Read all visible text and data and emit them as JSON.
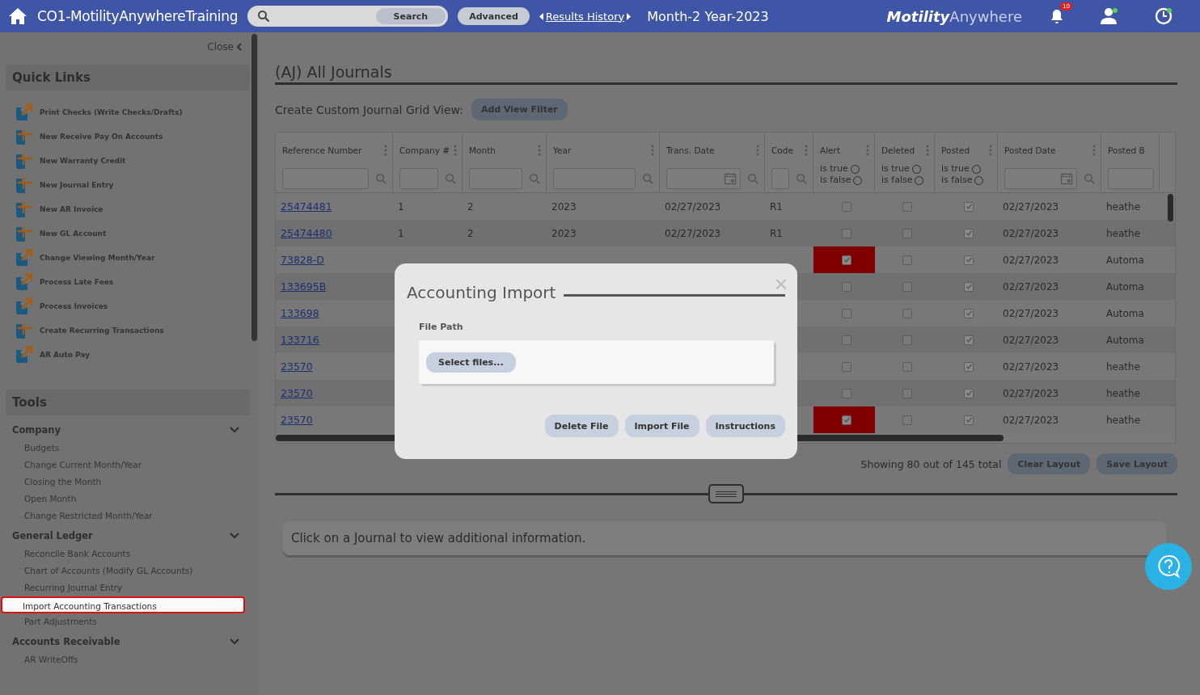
{
  "topbar": {
    "title": "CO1-MotilityAnywhereTraining",
    "search_button": "Search",
    "advanced_button": "Advanced",
    "history_link": "Results History",
    "period": "Month-2 Year-2023",
    "brand_bold": "Motility",
    "brand_light": "Anywhere",
    "notification_count": "10"
  },
  "sidebar": {
    "close": "Close",
    "quick_links_title": "Quick Links",
    "quick_links": [
      {
        "label": "Print Checks (Write Checks/Drafts)",
        "kind": "open"
      },
      {
        "label": "New Receive Pay On Accounts",
        "kind": "new"
      },
      {
        "label": "New Warranty Credit",
        "kind": "new"
      },
      {
        "label": "New Journal Entry",
        "kind": "new"
      },
      {
        "label": "New AR Invoice",
        "kind": "new"
      },
      {
        "label": "New GL Account",
        "kind": "new"
      },
      {
        "label": "Change Viewing Month/Year",
        "kind": "open"
      },
      {
        "label": "Process Late Fees",
        "kind": "open"
      },
      {
        "label": "Process Invoices",
        "kind": "open"
      },
      {
        "label": "Create Recurring Transactions",
        "kind": "new"
      },
      {
        "label": "AR Auto Pay",
        "kind": "open"
      }
    ],
    "tools_title": "Tools",
    "tools": [
      {
        "label": "Company",
        "expanded": true,
        "children": [
          {
            "label": "Budgets",
            "selected": false
          },
          {
            "label": "Change Current Month/Year",
            "selected": false
          },
          {
            "label": "Closing the Month",
            "selected": false
          },
          {
            "label": "Open Month",
            "selected": false
          },
          {
            "label": "Change Restricted Month/Year",
            "selected": false
          }
        ]
      },
      {
        "label": "General Ledger",
        "expanded": true,
        "children": [
          {
            "label": "Reconcile Bank Accounts",
            "selected": false
          },
          {
            "label": "Chart of Accounts (Modify GL Accounts)",
            "selected": false
          },
          {
            "label": "Recurring Journal Entry",
            "selected": false
          },
          {
            "label": "Import Accounting Transactions",
            "selected": true
          },
          {
            "label": "Part Adjustments",
            "selected": false
          }
        ]
      },
      {
        "label": "Accounts Receivable",
        "expanded": true,
        "children": [
          {
            "label": "AR WriteOffs",
            "selected": false
          }
        ]
      }
    ]
  },
  "main": {
    "title": "(AJ) All Journals",
    "custom_view_label": "Create Custom Journal Grid View:",
    "add_filter_button": "Add View Filter",
    "table": {
      "columns": [
        {
          "label": "Reference Number",
          "kind": "text"
        },
        {
          "label": "Company #",
          "kind": "text"
        },
        {
          "label": "Month",
          "kind": "text"
        },
        {
          "label": "Year",
          "kind": "text"
        },
        {
          "label": "Trans. Date",
          "kind": "date"
        },
        {
          "label": "Code",
          "kind": "text"
        },
        {
          "label": "Alert",
          "kind": "bool",
          "filter_true": "is true",
          "filter_false": "is false"
        },
        {
          "label": "Deleted",
          "kind": "bool",
          "filter_true": "is true",
          "filter_false": "is false"
        },
        {
          "label": "Posted",
          "kind": "bool",
          "filter_true": "is true",
          "filter_false": "is false"
        },
        {
          "label": "Posted Date",
          "kind": "date"
        },
        {
          "label": "Posted B",
          "kind": "text"
        }
      ],
      "rows": [
        {
          "ref": "25474481",
          "company": "1",
          "month": "2",
          "year": "2023",
          "trans_date": "02/27/2023",
          "code": "R1",
          "alert": false,
          "deleted": false,
          "posted": true,
          "posted_date": "02/27/2023",
          "posted_by": "heathe"
        },
        {
          "ref": "25474480",
          "company": "1",
          "month": "2",
          "year": "2023",
          "trans_date": "02/27/2023",
          "code": "R1",
          "alert": false,
          "deleted": false,
          "posted": true,
          "posted_date": "02/27/2023",
          "posted_by": "heathe"
        },
        {
          "ref": "73828-D",
          "alert": true,
          "deleted": false,
          "posted": true,
          "posted_date": "02/27/2023",
          "posted_by": "Automa"
        },
        {
          "ref": "133695B",
          "alert": false,
          "deleted": false,
          "posted": true,
          "posted_date": "02/27/2023",
          "posted_by": "Automa"
        },
        {
          "ref": "133698",
          "alert": false,
          "deleted": false,
          "posted": true,
          "posted_date": "02/27/2023",
          "posted_by": "Automa"
        },
        {
          "ref": "133716",
          "alert": false,
          "deleted": false,
          "posted": true,
          "posted_date": "02/27/2023",
          "posted_by": "Automa"
        },
        {
          "ref": "23570",
          "alert": false,
          "deleted": false,
          "posted": true,
          "posted_date": "02/27/2023",
          "posted_by": "heathe"
        },
        {
          "ref": "23570",
          "alert": false,
          "deleted": false,
          "posted": true,
          "posted_date": "02/27/2023",
          "posted_by": "heathe"
        },
        {
          "ref": "23570",
          "alert": true,
          "deleted": false,
          "posted": true,
          "posted_date": "02/27/2023",
          "posted_by": "heathe"
        }
      ]
    },
    "showing": "Showing 80 out of 145 total",
    "clear_layout_button": "Clear Layout",
    "save_layout_button": "Save Layout",
    "info_message": "Click on a Journal to view additional information."
  },
  "modal": {
    "title": "Accounting Import",
    "close": "×",
    "field_label": "File Path",
    "select_button": "Select files...",
    "buttons": [
      "Delete File",
      "Import File",
      "Instructions"
    ]
  }
}
